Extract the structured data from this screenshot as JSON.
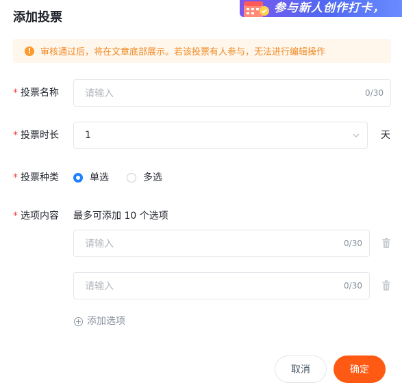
{
  "dialog": {
    "title": "添加投票"
  },
  "banner": {
    "text": "参与新人创作打卡，"
  },
  "notice": {
    "icon": "warning-icon",
    "text": "审核通过后，将在文章底部展示。若该投票有人参与，无法进行编辑操作"
  },
  "fields": {
    "name": {
      "required_mark": "*",
      "label": "投票名称",
      "placeholder": "请输入",
      "counter": "0/30"
    },
    "duration": {
      "required_mark": "*",
      "label": "投票时长",
      "value": "1",
      "unit": "天"
    },
    "type": {
      "required_mark": "*",
      "label": "投票种类",
      "options": [
        {
          "label": "单选",
          "checked": true
        },
        {
          "label": "多选",
          "checked": false
        }
      ]
    },
    "options": {
      "required_mark": "*",
      "label": "选项内容",
      "hint": "最多可添加 10 个选项",
      "items": [
        {
          "placeholder": "请输入",
          "counter": "0/30"
        },
        {
          "placeholder": "请输入",
          "counter": "0/30"
        }
      ],
      "add_label": "添加选项"
    }
  },
  "footer": {
    "cancel_label": "取消",
    "confirm_label": "确定"
  },
  "colors": {
    "accent": "#1e80ff",
    "primary_button": "#fe5a13",
    "required": "#f53f3f",
    "notice_bg": "#fff6ec",
    "notice_text": "#f08a24"
  }
}
